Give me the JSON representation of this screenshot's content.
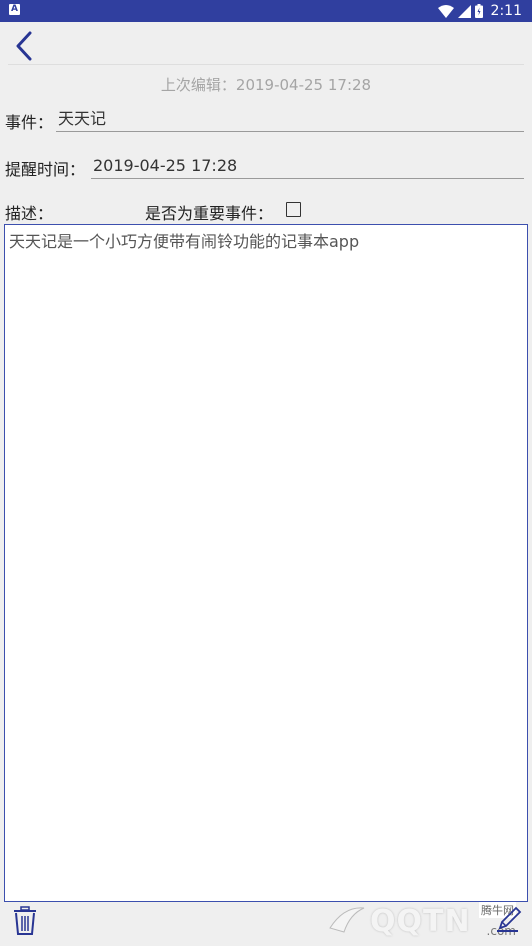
{
  "status_bar": {
    "time": "2:11",
    "notification_badge": "A"
  },
  "header": {
    "last_edit_label": "上次编辑：",
    "last_edit_value": "2019-04-25 17:28"
  },
  "form": {
    "event_label": "事件：",
    "event_value": "天天记",
    "remind_label": "提醒时间：",
    "remind_value": "2019-04-25 17:28",
    "desc_label": "描述：",
    "important_label": "是否为重要事件：",
    "important_checked": false,
    "desc_value": "天天记是一个小巧方便带有闹铃功能的记事本app"
  },
  "icons": {
    "back": "back-arrow-icon",
    "delete": "trash-icon",
    "edit": "edit-icon"
  },
  "watermark": {
    "text": "QQTN",
    "tag": "腾牛网",
    "domain": ".com"
  },
  "colors": {
    "status_bar": "#303f9f",
    "accent": "#3c4fae",
    "background": "#efefef"
  }
}
